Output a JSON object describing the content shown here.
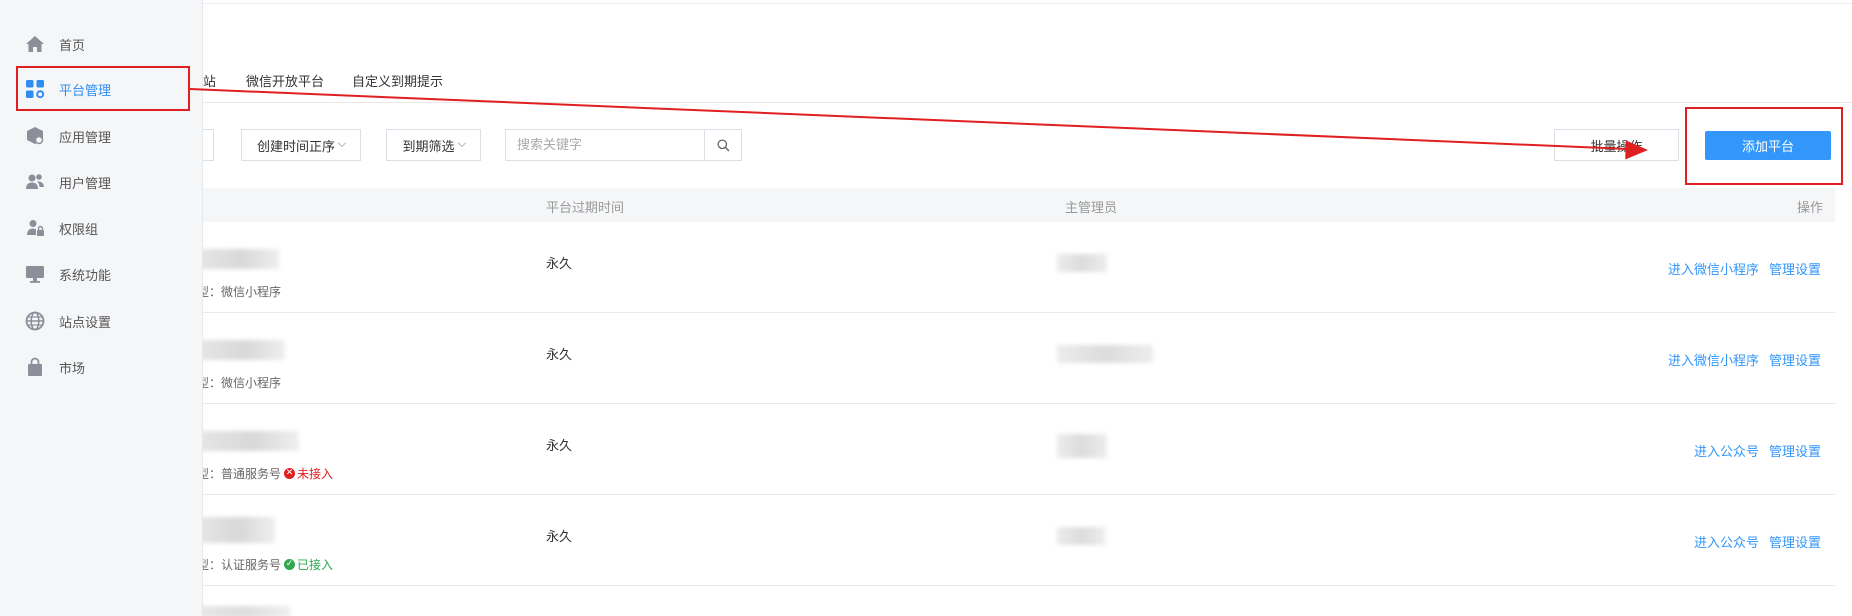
{
  "sidebar": {
    "items": [
      {
        "label": "首页",
        "icon": "home-icon"
      },
      {
        "label": "平台管理",
        "icon": "platform-grid-icon",
        "active": true
      },
      {
        "label": "应用管理",
        "icon": "app-box-icon"
      },
      {
        "label": "用户管理",
        "icon": "users-icon"
      },
      {
        "label": "权限组",
        "icon": "user-lock-icon"
      },
      {
        "label": "系统功能",
        "icon": "monitor-icon"
      },
      {
        "label": "站点设置",
        "icon": "globe-icon"
      },
      {
        "label": "市场",
        "icon": "shopping-bag-icon"
      }
    ]
  },
  "tabs": {
    "partial": "站",
    "wechat_open": "微信开放平台",
    "custom_expiry": "自定义到期提示"
  },
  "toolbar": {
    "sort_label": "创建时间正序",
    "expiry_filter_label": "到期筛选",
    "search_placeholder": "搜索关键字",
    "batch_label": "批量操作",
    "add_label": "添加平台"
  },
  "table": {
    "headers": {
      "expiry": "平台过期时间",
      "admin": "主管理员",
      "actions": "操作"
    },
    "rows": [
      {
        "type_text": "型：微信小程序",
        "status": "",
        "expiry": "永久",
        "action_enter": "进入微信小程序",
        "action_manage": "管理设置"
      },
      {
        "type_text": "型：微信小程序",
        "status": "",
        "expiry": "永久",
        "action_enter": "进入微信小程序",
        "action_manage": "管理设置"
      },
      {
        "type_text": "型：普通服务号",
        "status": "未接入",
        "expiry": "永久",
        "action_enter": "进入公众号",
        "action_manage": "管理设置"
      },
      {
        "type_text": "型：认证服务号",
        "status": "已接入",
        "expiry": "永久",
        "action_enter": "进入公众号",
        "action_manage": "管理设置"
      }
    ]
  },
  "colors": {
    "accent": "#3296fa",
    "annotation_red": "#e02020",
    "status_bad": "#e02020",
    "status_good": "#2fa84f"
  }
}
